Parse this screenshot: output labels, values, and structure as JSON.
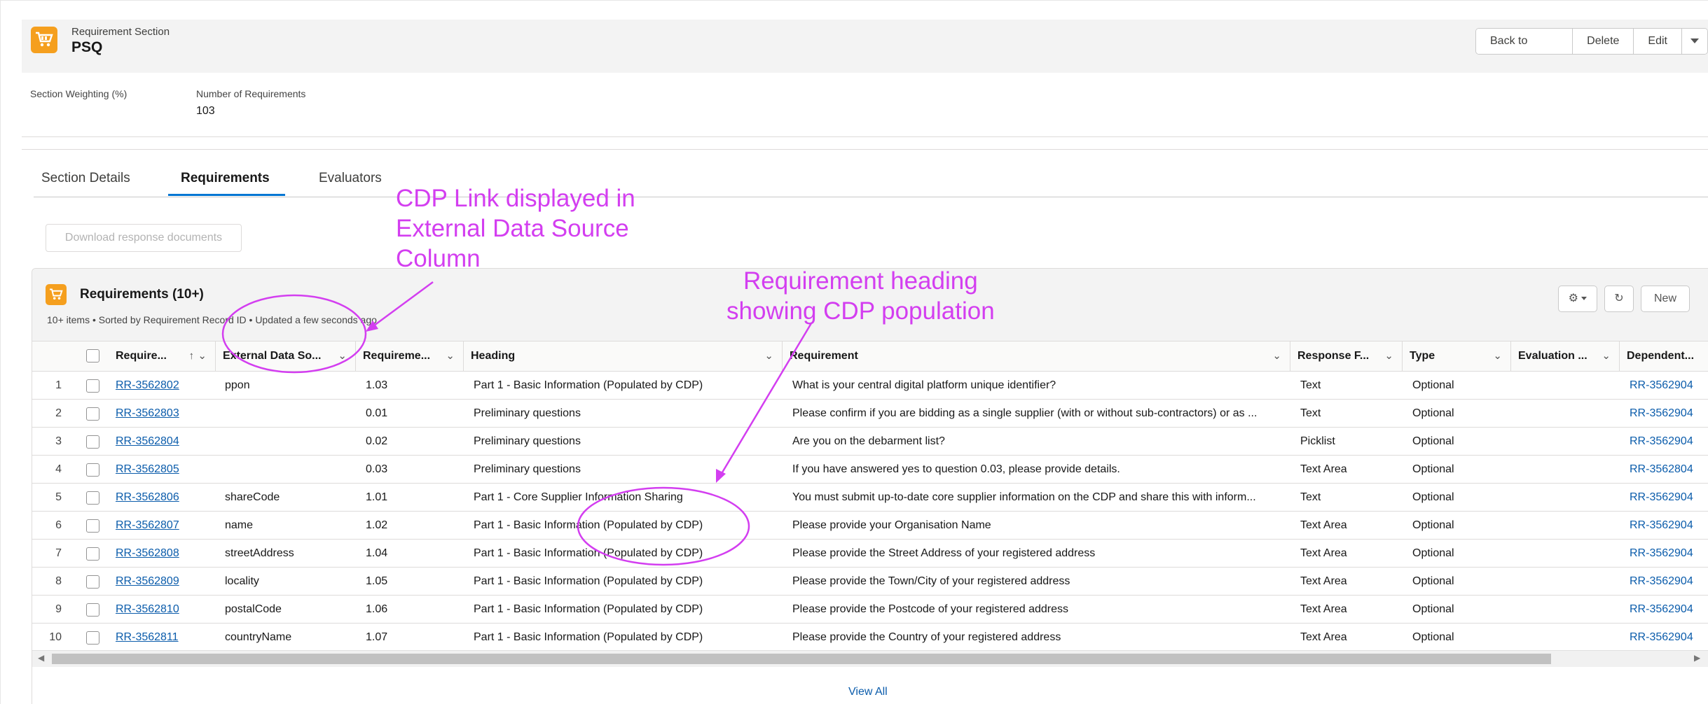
{
  "header": {
    "object_label": "Requirement Section",
    "record_name": "PSQ",
    "buttons": [
      "Back to Project",
      "Delete",
      "Edit"
    ]
  },
  "fields": {
    "section_weighting_label": "Section Weighting (%)",
    "section_weighting_value": "",
    "num_requirements_label": "Number of Requirements",
    "num_requirements_value": "103"
  },
  "tabs": [
    "Section Details",
    "Requirements",
    "Evaluators"
  ],
  "download_button": "Download response documents",
  "card": {
    "title": "Requirements (10+)",
    "meta": "10+ items • Sorted by Requirement Record ID • Updated a few seconds ago",
    "new_button": "New"
  },
  "table": {
    "columns": [
      "Require...",
      "External Data So...",
      "Requireme...",
      "Heading",
      "Requirement",
      "Response F...",
      "Type",
      "Evaluation ...",
      "Dependent..."
    ],
    "rows": [
      {
        "n": "1",
        "id": "RR-3562802",
        "ext": "ppon",
        "req_no": "1.03",
        "heading": "Part 1 - Basic Information (Populated by CDP)",
        "requirement": "What is your central digital platform unique identifier?",
        "response": "Text",
        "type": "Optional",
        "eval": "",
        "dep": "RR-3562904"
      },
      {
        "n": "2",
        "id": "RR-3562803",
        "ext": "",
        "req_no": "0.01",
        "heading": "Preliminary questions",
        "requirement": "Please confirm if you are bidding as a single supplier (with or without sub-contractors) or as ...",
        "response": "Text",
        "type": "Optional",
        "eval": "",
        "dep": "RR-3562904"
      },
      {
        "n": "3",
        "id": "RR-3562804",
        "ext": "",
        "req_no": "0.02",
        "heading": "Preliminary questions",
        "requirement": "Are you on the debarment list?",
        "response": "Picklist",
        "type": "Optional",
        "eval": "",
        "dep": "RR-3562904"
      },
      {
        "n": "4",
        "id": "RR-3562805",
        "ext": "",
        "req_no": "0.03",
        "heading": "Preliminary questions",
        "requirement": "If you have answered yes to question 0.03, please provide details.",
        "response": "Text Area",
        "type": "Optional",
        "eval": "",
        "dep": "RR-3562804"
      },
      {
        "n": "5",
        "id": "RR-3562806",
        "ext": "shareCode",
        "req_no": "1.01",
        "heading": "Part 1 - Core Supplier Information Sharing",
        "requirement": "You must submit up-to-date core supplier information on the CDP and share this with inform...",
        "response": "Text",
        "type": "Optional",
        "eval": "",
        "dep": "RR-3562904"
      },
      {
        "n": "6",
        "id": "RR-3562807",
        "ext": "name",
        "req_no": "1.02",
        "heading": "Part 1 - Basic Information (Populated by CDP)",
        "requirement": "Please provide your Organisation Name",
        "response": "Text Area",
        "type": "Optional",
        "eval": "",
        "dep": "RR-3562904"
      },
      {
        "n": "7",
        "id": "RR-3562808",
        "ext": "streetAddress",
        "req_no": "1.04",
        "heading": "Part 1 - Basic Information (Populated by CDP)",
        "requirement": "Please provide the Street Address of your registered address",
        "response": "Text Area",
        "type": "Optional",
        "eval": "",
        "dep": "RR-3562904"
      },
      {
        "n": "8",
        "id": "RR-3562809",
        "ext": "locality",
        "req_no": "1.05",
        "heading": "Part 1 - Basic Information (Populated by CDP)",
        "requirement": "Please provide the Town/City of your registered address",
        "response": "Text Area",
        "type": "Optional",
        "eval": "",
        "dep": "RR-3562904"
      },
      {
        "n": "9",
        "id": "RR-3562810",
        "ext": "postalCode",
        "req_no": "1.06",
        "heading": "Part 1 - Basic Information (Populated by CDP)",
        "requirement": "Please provide the Postcode of your registered address",
        "response": "Text Area",
        "type": "Optional",
        "eval": "",
        "dep": "RR-3562904"
      },
      {
        "n": "10",
        "id": "RR-3562811",
        "ext": "countryName",
        "req_no": "1.07",
        "heading": "Part 1 - Basic Information (Populated by CDP)",
        "requirement": "Please provide the Country of your registered address",
        "response": "Text Area",
        "type": "Optional",
        "eval": "",
        "dep": "RR-3562904"
      }
    ]
  },
  "view_all": "View All",
  "annotations": {
    "cdp_link": [
      "CDP Link displayed in",
      "External Data Source",
      "Column"
    ],
    "heading_note": [
      "Requirement heading",
      "showing CDP population"
    ],
    "color": "#d33ef0"
  },
  "colors": {
    "brand_icon": "#f59f1e",
    "link": "#0b5cab",
    "active_tab": "#0176d3"
  }
}
